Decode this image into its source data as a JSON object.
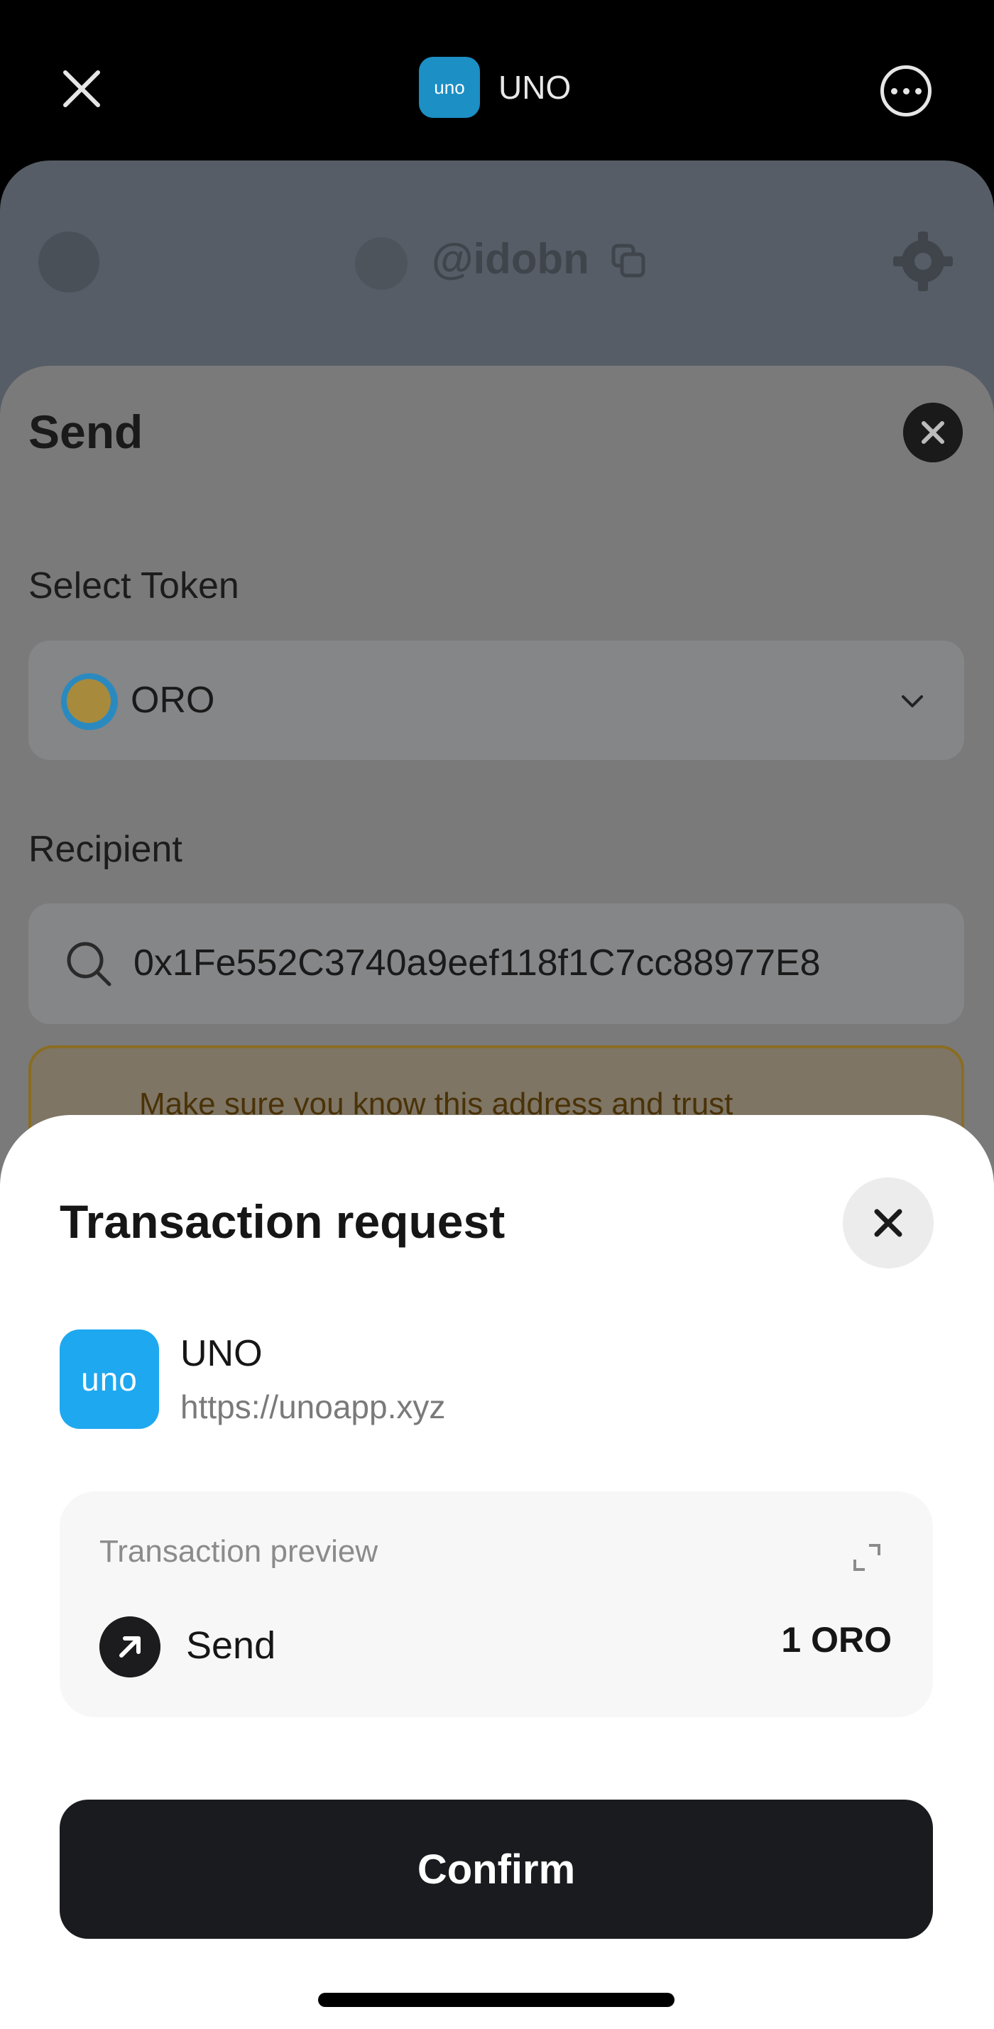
{
  "topbar": {
    "app_logo_text": "uno",
    "title": "UNO",
    "close_icon": "close-icon",
    "more_icon": "more-icon"
  },
  "background_app": {
    "username": "@idobn"
  },
  "send_sheet": {
    "title": "Send",
    "select_token_label": "Select Token",
    "selected_token": "ORO",
    "recipient_label": "Recipient",
    "recipient_value": "0x1Fe552C3740a9eef118f1C7cc88977E8",
    "warning_text": "Make sure you know this address and trust"
  },
  "transaction_modal": {
    "title": "Transaction request",
    "app_logo_text": "uno",
    "app_name": "UNO",
    "app_url": "https://unoapp.xyz",
    "preview_title": "Transaction preview",
    "action_label": "Send",
    "amount": "1 ORO",
    "confirm_label": "Confirm"
  },
  "colors": {
    "modal_bg": "#ffffff",
    "confirm_bg": "#1a1b1f",
    "uno_brand": "#1ea8f0"
  }
}
